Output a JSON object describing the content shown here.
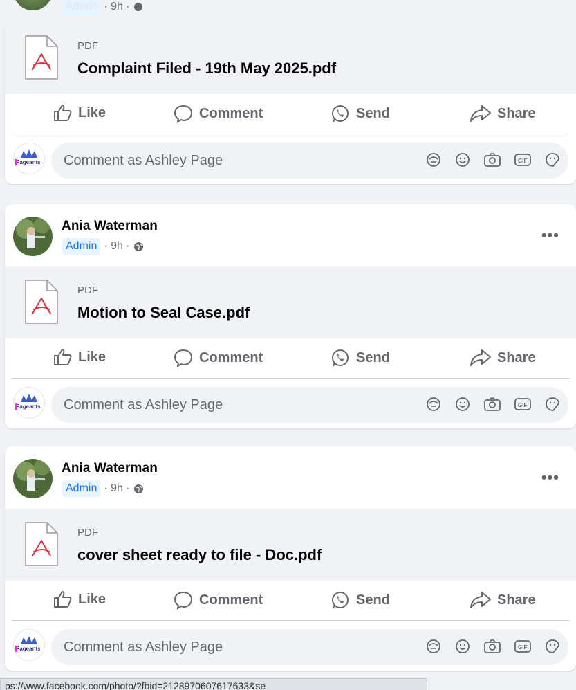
{
  "top_meta": {
    "admin": "Admin",
    "time": "· 9h ·"
  },
  "posts": [
    {
      "file_type": "PDF",
      "file_name": "Complaint Filed - 19th May 2025.pdf"
    },
    {
      "author": "Ania Waterman",
      "admin": "Admin",
      "time": "· 9h ·",
      "more": "•••",
      "file_type": "PDF",
      "file_name": "Motion to Seal Case.pdf"
    },
    {
      "author": "Ania Waterman",
      "admin": "Admin",
      "time": "· 9h ·",
      "more": "•••",
      "file_type": "PDF",
      "file_name": "cover sheet ready to file - Doc.pdf"
    }
  ],
  "actions": {
    "like": "Like",
    "comment": "Comment",
    "send": "Send",
    "share": "Share"
  },
  "composer": {
    "placeholder": "Comment as Ashley Page",
    "page_logo_text": "Pageants"
  },
  "status_bar": {
    "url": "ps://www.facebook.com/photo/?fbid=2128970607617633&se"
  },
  "colors": {
    "accent": "#1877f2",
    "pdf_red": "#e0303f",
    "muted": "#65676b",
    "bg": "#f0f2f5"
  }
}
